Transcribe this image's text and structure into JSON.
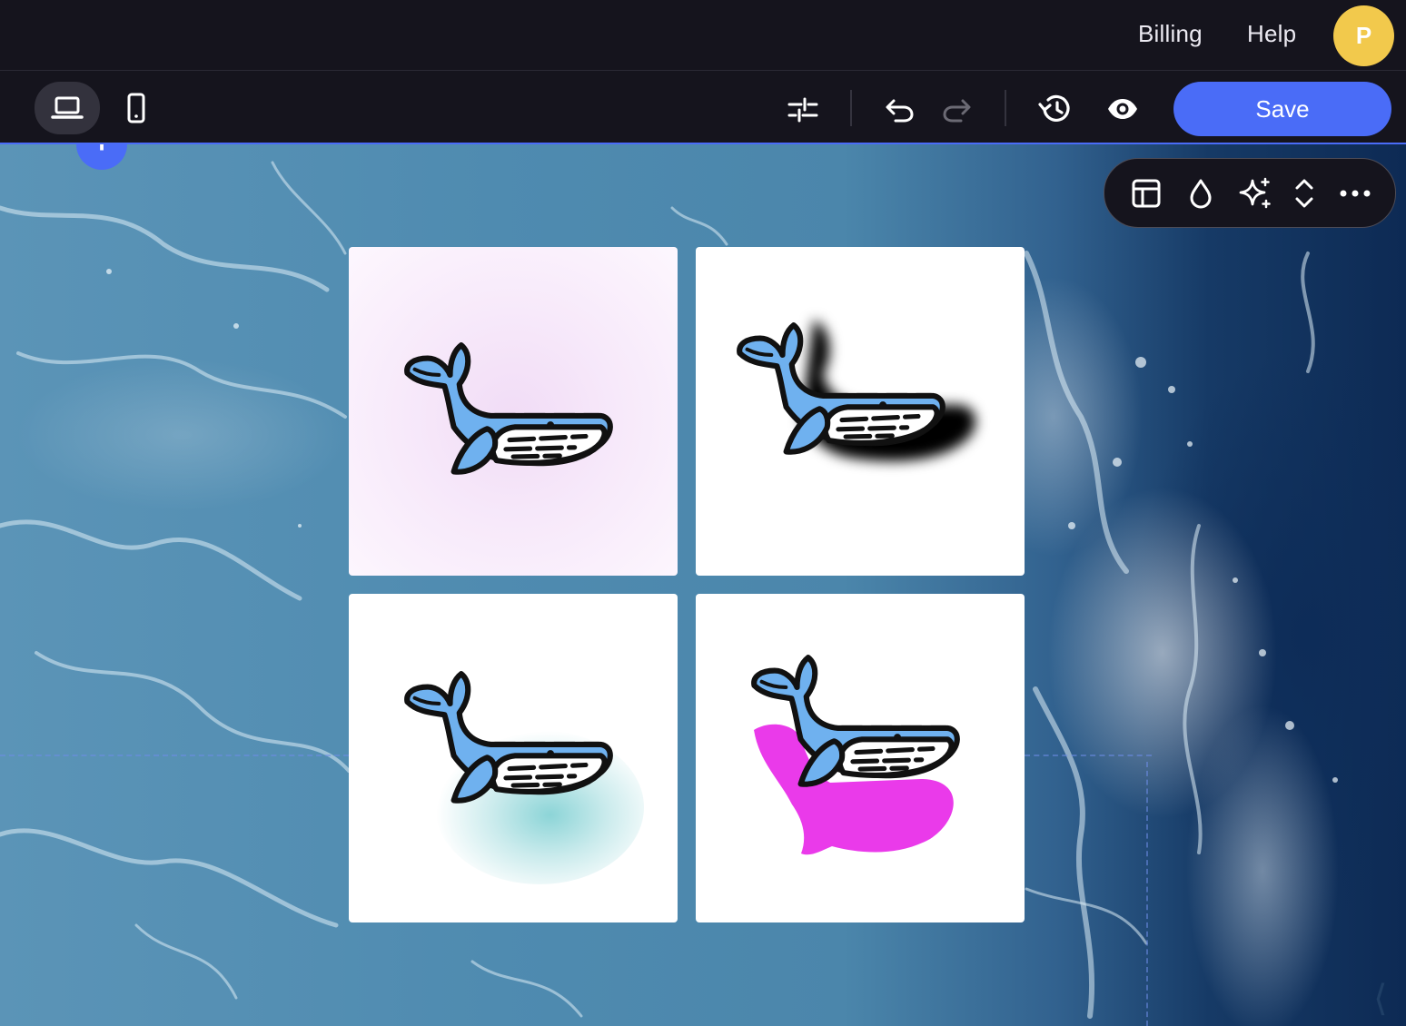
{
  "header": {
    "billing_label": "Billing",
    "help_label": "Help",
    "avatar_initial": "P"
  },
  "toolbar": {
    "save_label": "Save",
    "device_active": "desktop",
    "icons": [
      "laptop-icon",
      "mobile-icon",
      "sliders-icon",
      "undo-icon",
      "redo-icon",
      "history-icon",
      "eye-icon"
    ]
  },
  "element_toolbar": {
    "icons": [
      "layout-icon",
      "droplet-icon",
      "sparkle-icon",
      "chevron-up-down-icon",
      "more-icon"
    ]
  },
  "canvas": {
    "add_section_symbol": "+"
  },
  "gallery": {
    "tiles": [
      {
        "effect": "pink-radial-background",
        "icon": "whale-icon"
      },
      {
        "effect": "black-drop-shadow",
        "icon": "whale-icon"
      },
      {
        "effect": "teal-glow",
        "icon": "whale-icon"
      },
      {
        "effect": "magenta-offset-shape",
        "icon": "whale-icon"
      }
    ]
  },
  "colors": {
    "accent": "#4a6cf7",
    "avatar": "#f2c94c",
    "bar_background": "#15141d",
    "whale_body": "#6fb1ef",
    "whale_outline": "#111111",
    "tile_magenta": "#ea3aea",
    "tile_teal_glow": "#78cdd0",
    "tile_pink_bg": "#f1dcf6"
  }
}
